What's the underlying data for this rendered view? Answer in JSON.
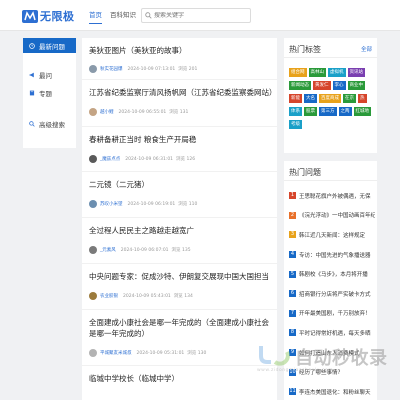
{
  "header": {
    "logo_text": "无限极",
    "nav": [
      "首页",
      "百科知识",
      "标签"
    ],
    "search_placeholder": "搜索关键字"
  },
  "sidebar": {
    "items": [
      {
        "label": "最新问题",
        "icon": "clock-icon"
      },
      {
        "label": "最问",
        "icon": "megaphone-icon"
      },
      {
        "label": "专题",
        "icon": "book-icon"
      },
      {
        "label": "高级搜索",
        "icon": "search-icon"
      }
    ]
  },
  "posts": [
    {
      "title": "美狄亚图片（美狄亚的故事）",
      "author": "秋实花园爆",
      "date": "2024-10-09 07:13:01",
      "views": "浏览 201",
      "avatar_color": "#8a9aaa"
    },
    {
      "title": "江苏省纪委监察厅清风扬帆网（江苏省纪委监察委网站）",
      "author": "越小鲤",
      "date": "2024-10-09 06:55:01",
      "views": "浏览 131",
      "avatar_color": "#c4a484"
    },
    {
      "title": "春耕备耕正当时 粮食生产开局稳",
      "author": "_魔兹点点",
      "date": "2024-10-09 06:31:01",
      "views": "浏览 126",
      "avatar_color": "#5a5a5a"
    },
    {
      "title": "二元镜（二元猪）",
      "author": "苏叹小米望",
      "date": "2024-10-09 06:19:01",
      "views": "浏览 110",
      "avatar_color": "#6c8fb0"
    },
    {
      "title": "全过程人民民主之路越走越宽广",
      "author": "_元素风",
      "date": "2024-10-09 06:07:01",
      "views": "浏览 135",
      "avatar_color": "#7a7a7a"
    },
    {
      "title": "中央问题专家：促成沙特、伊朗复交展现中国大国担当",
      "author": "农业胶银",
      "date": "2024-10-09 05:43:01",
      "views": "浏览 134",
      "avatar_color": "#9c7b3c"
    },
    {
      "title": "全面建成小康社会是哪一年完成的（全面建成小康社会是哪一年完成的）",
      "author": "平城聚友米城叔",
      "date": "2024-10-09 05:31:01",
      "views": "浏览 130",
      "avatar_color": "#b3b3b3"
    },
    {
      "title": "临城中学校长（临城中学）",
      "author": "",
      "date": "",
      "views": "",
      "avatar_color": "#888888"
    }
  ],
  "tags_box": {
    "title": "热门标签",
    "more": "全部",
    "tags": [
      {
        "label": "组合网",
        "color": "#e8a21b"
      },
      {
        "label": "高林山",
        "color": "#2a9a3a"
      },
      {
        "label": "虚拟机",
        "color": "#1aa0c8"
      },
      {
        "label": "资讯站",
        "color": "#7a3fb0"
      },
      {
        "label": "新闻动态",
        "color": "#2a9a3a"
      },
      {
        "label": "黄发仁",
        "color": "#d6452b"
      },
      {
        "label": "李心",
        "color": "#1769c7"
      },
      {
        "label": "商业中",
        "color": "#2a9a3a"
      },
      {
        "label": "新能",
        "color": "#d6452b"
      },
      {
        "label": "大名",
        "color": "#1769c7"
      },
      {
        "label": "百度商成",
        "color": "#e8a21b"
      },
      {
        "label": "在京",
        "color": "#2a9a3a"
      },
      {
        "label": "热",
        "color": "#d6452b"
      },
      {
        "label": "体系",
        "color": "#1aa0c8"
      },
      {
        "label": "股票",
        "color": "#2a9a3a"
      },
      {
        "label": "第三方",
        "color": "#1769c7"
      },
      {
        "label": "之两",
        "color": "#1769c7"
      },
      {
        "label": "红城地",
        "color": "#2a9a3a"
      },
      {
        "label": "考级",
        "color": "#1aa0c8"
      }
    ]
  },
  "hot_box": {
    "title": "热门问题",
    "items": [
      {
        "rank": "1",
        "text": "王思聪花旗户外被偶遇，无保",
        "color": "#d6452b"
      },
      {
        "rank": "2",
        "text": "《浣光浮动》一中国动画百年纪",
        "color": "#e8702a"
      },
      {
        "rank": "3",
        "text": "韩江近几天新闻：这样规定",
        "color": "#e8a21b"
      },
      {
        "rank": "4",
        "text": "专访：中国先进的气象播送器",
        "color": "#1769c7"
      },
      {
        "rank": "5",
        "text": "韩剧校《马步》，本月将开播",
        "color": "#1769c7"
      },
      {
        "rank": "6",
        "text": "招商银行分店将严实破卡方式",
        "color": "#1769c7"
      },
      {
        "rank": "7",
        "text": "开年最美国剧，千万别放弃！",
        "color": "#1769c7"
      },
      {
        "rank": "8",
        "text": "平时记得常好机遇，每天多晒",
        "color": "#1769c7"
      },
      {
        "rank": "9",
        "text": "如何打造山东人消费模式",
        "color": "#1769c7"
      },
      {
        "rank": "10",
        "text": "经历了哪些事情？",
        "color": "#1769c7"
      },
      {
        "rank": "11",
        "text": "李连杰美国退化：和粉丝聊天",
        "color": "#1769c7"
      }
    ]
  },
  "watermark": {
    "text": "自动秒收录",
    "sub": "www.zidongmiaoshoulu.com"
  }
}
